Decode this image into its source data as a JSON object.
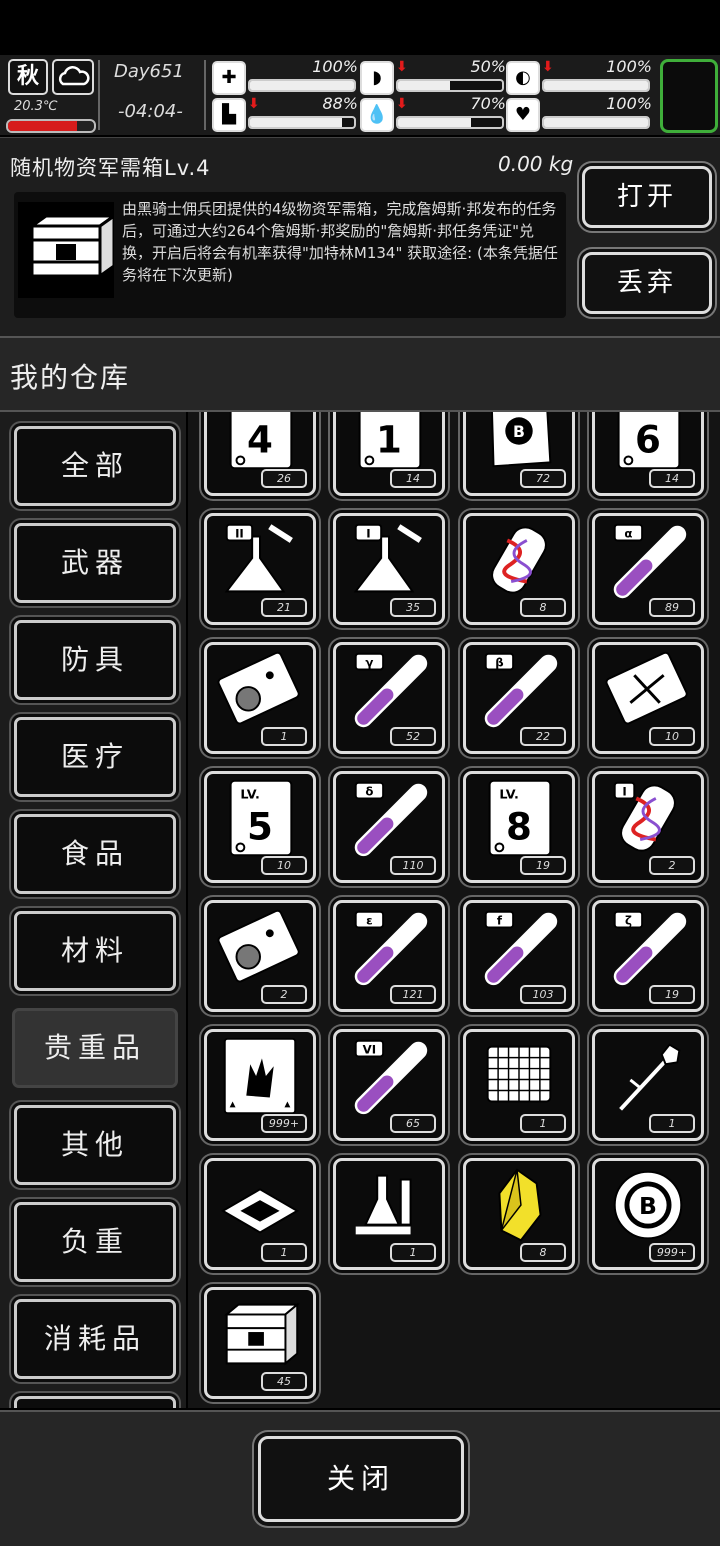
{
  "status": {
    "season": "秋",
    "weather_icon": "cloud-icon",
    "temperature": "20.3℃",
    "temperature_level": 0.8,
    "day": "Day651",
    "time": "-04:04-",
    "stats": [
      {
        "name": "health",
        "icon": "medkit-icon",
        "value": "100%",
        "level": 1.0,
        "trend": ""
      },
      {
        "name": "stamina",
        "icon": "boot-icon",
        "value": "88%",
        "level": 0.88,
        "trend": "down"
      },
      {
        "name": "hunger",
        "icon": "stomach-icon",
        "value": "50%",
        "level": 0.5,
        "trend": "down"
      },
      {
        "name": "thirst",
        "icon": "water-drop-icon",
        "value": "70%",
        "level": 0.7,
        "trend": "down"
      },
      {
        "name": "medicine",
        "icon": "pill-icon",
        "value": "100%",
        "level": 1.0,
        "trend": "down"
      },
      {
        "name": "mood",
        "icon": "heart-icon",
        "value": "100%",
        "level": 1.0,
        "trend": ""
      }
    ]
  },
  "detail": {
    "title": "随机物资军需箱Lv.4",
    "weight": "0.00 kg",
    "description": "由黑骑士佣兵团提供的4级物资军需箱，完成詹姆斯·邦发布的任务后，可通过大约264个詹姆斯·邦奖励的\"詹姆斯·邦任务凭证\"兑换，开启后将会有机率获得\"加特林M134\" 获取途径: (本条凭据任务将在下次更新)",
    "open_label": "打开",
    "discard_label": "丢弃"
  },
  "warehouse": {
    "title": "我的仓库",
    "categories": [
      "全部",
      "武器",
      "防具",
      "医疗",
      "食品",
      "材料",
      "贵重品",
      "其他",
      "负重",
      "消耗品"
    ],
    "active_category": "贵重品",
    "items": [
      {
        "name": "level-4-ticket",
        "icon": "lv-ticket-icon",
        "label": "4",
        "count": "26"
      },
      {
        "name": "level-1-ticket",
        "icon": "lv-ticket-icon",
        "label": "1",
        "count": "14"
      },
      {
        "name": "bitcoin-map",
        "icon": "bitcoin-map-icon",
        "label": "B",
        "count": "72"
      },
      {
        "name": "level-6-ticket",
        "icon": "lv-ticket-icon",
        "label": "6",
        "count": "14"
      },
      {
        "name": "flask-ii",
        "icon": "flask-icon",
        "label": "II",
        "count": "21"
      },
      {
        "name": "flask-i",
        "icon": "flask-icon",
        "label": "I",
        "count": "35"
      },
      {
        "name": "dna-capsule-red",
        "icon": "dna-capsule-icon",
        "label": "",
        "count": "8"
      },
      {
        "name": "test-tube-alpha",
        "icon": "test-tube-icon",
        "label": "α",
        "count": "89"
      },
      {
        "name": "portrait-ticket",
        "icon": "portrait-ticket-icon",
        "label": "",
        "count": "1"
      },
      {
        "name": "test-tube-gamma",
        "icon": "test-tube-icon",
        "label": "γ",
        "count": "52"
      },
      {
        "name": "test-tube-beta",
        "icon": "test-tube-icon",
        "label": "β",
        "count": "22"
      },
      {
        "name": "crossed-ticket",
        "icon": "crossed-ticket-icon",
        "label": "",
        "count": "10"
      },
      {
        "name": "level-5-ticket",
        "icon": "lv-ticket-icon",
        "label": "5",
        "count": "10"
      },
      {
        "name": "test-tube-delta",
        "icon": "test-tube-icon",
        "label": "δ",
        "count": "110"
      },
      {
        "name": "level-8-ticket",
        "icon": "lv-ticket-icon",
        "label": "8",
        "count": "19"
      },
      {
        "name": "dna-capsule-i",
        "icon": "dna-capsule-icon",
        "label": "I",
        "count": "2"
      },
      {
        "name": "portrait-ticket-2",
        "icon": "portrait-ticket-icon",
        "label": "",
        "count": "2"
      },
      {
        "name": "test-tube-epsilon",
        "icon": "test-tube-icon",
        "label": "ε",
        "count": "121"
      },
      {
        "name": "test-tube-f",
        "icon": "test-tube-icon",
        "label": "f",
        "count": "103"
      },
      {
        "name": "test-tube-zeta",
        "icon": "test-tube-icon",
        "label": "ζ",
        "count": "19"
      },
      {
        "name": "monster-card",
        "icon": "monster-card-icon",
        "label": "",
        "count": "999+"
      },
      {
        "name": "test-tube-vi",
        "icon": "test-tube-icon",
        "label": "VI",
        "count": "65"
      },
      {
        "name": "grid-panel",
        "icon": "grid-panel-icon",
        "label": "",
        "count": "1"
      },
      {
        "name": "crystal-syringe",
        "icon": "syringe-icon",
        "label": "",
        "count": "1"
      },
      {
        "name": "cpu-chip",
        "icon": "cpu-chip-icon",
        "label": "",
        "count": "1"
      },
      {
        "name": "lab-equipment",
        "icon": "lab-equipment-icon",
        "label": "",
        "count": "1"
      },
      {
        "name": "yellow-crystal",
        "icon": "yellow-crystal-icon",
        "label": "",
        "count": "8"
      },
      {
        "name": "bitcoin-coin",
        "icon": "bitcoin-coin-icon",
        "label": "B",
        "count": "999+"
      },
      {
        "name": "supply-crate-lv4",
        "icon": "crate-icon",
        "label": "",
        "count": "45"
      }
    ]
  },
  "bottom": {
    "close_label": "关闭"
  }
}
